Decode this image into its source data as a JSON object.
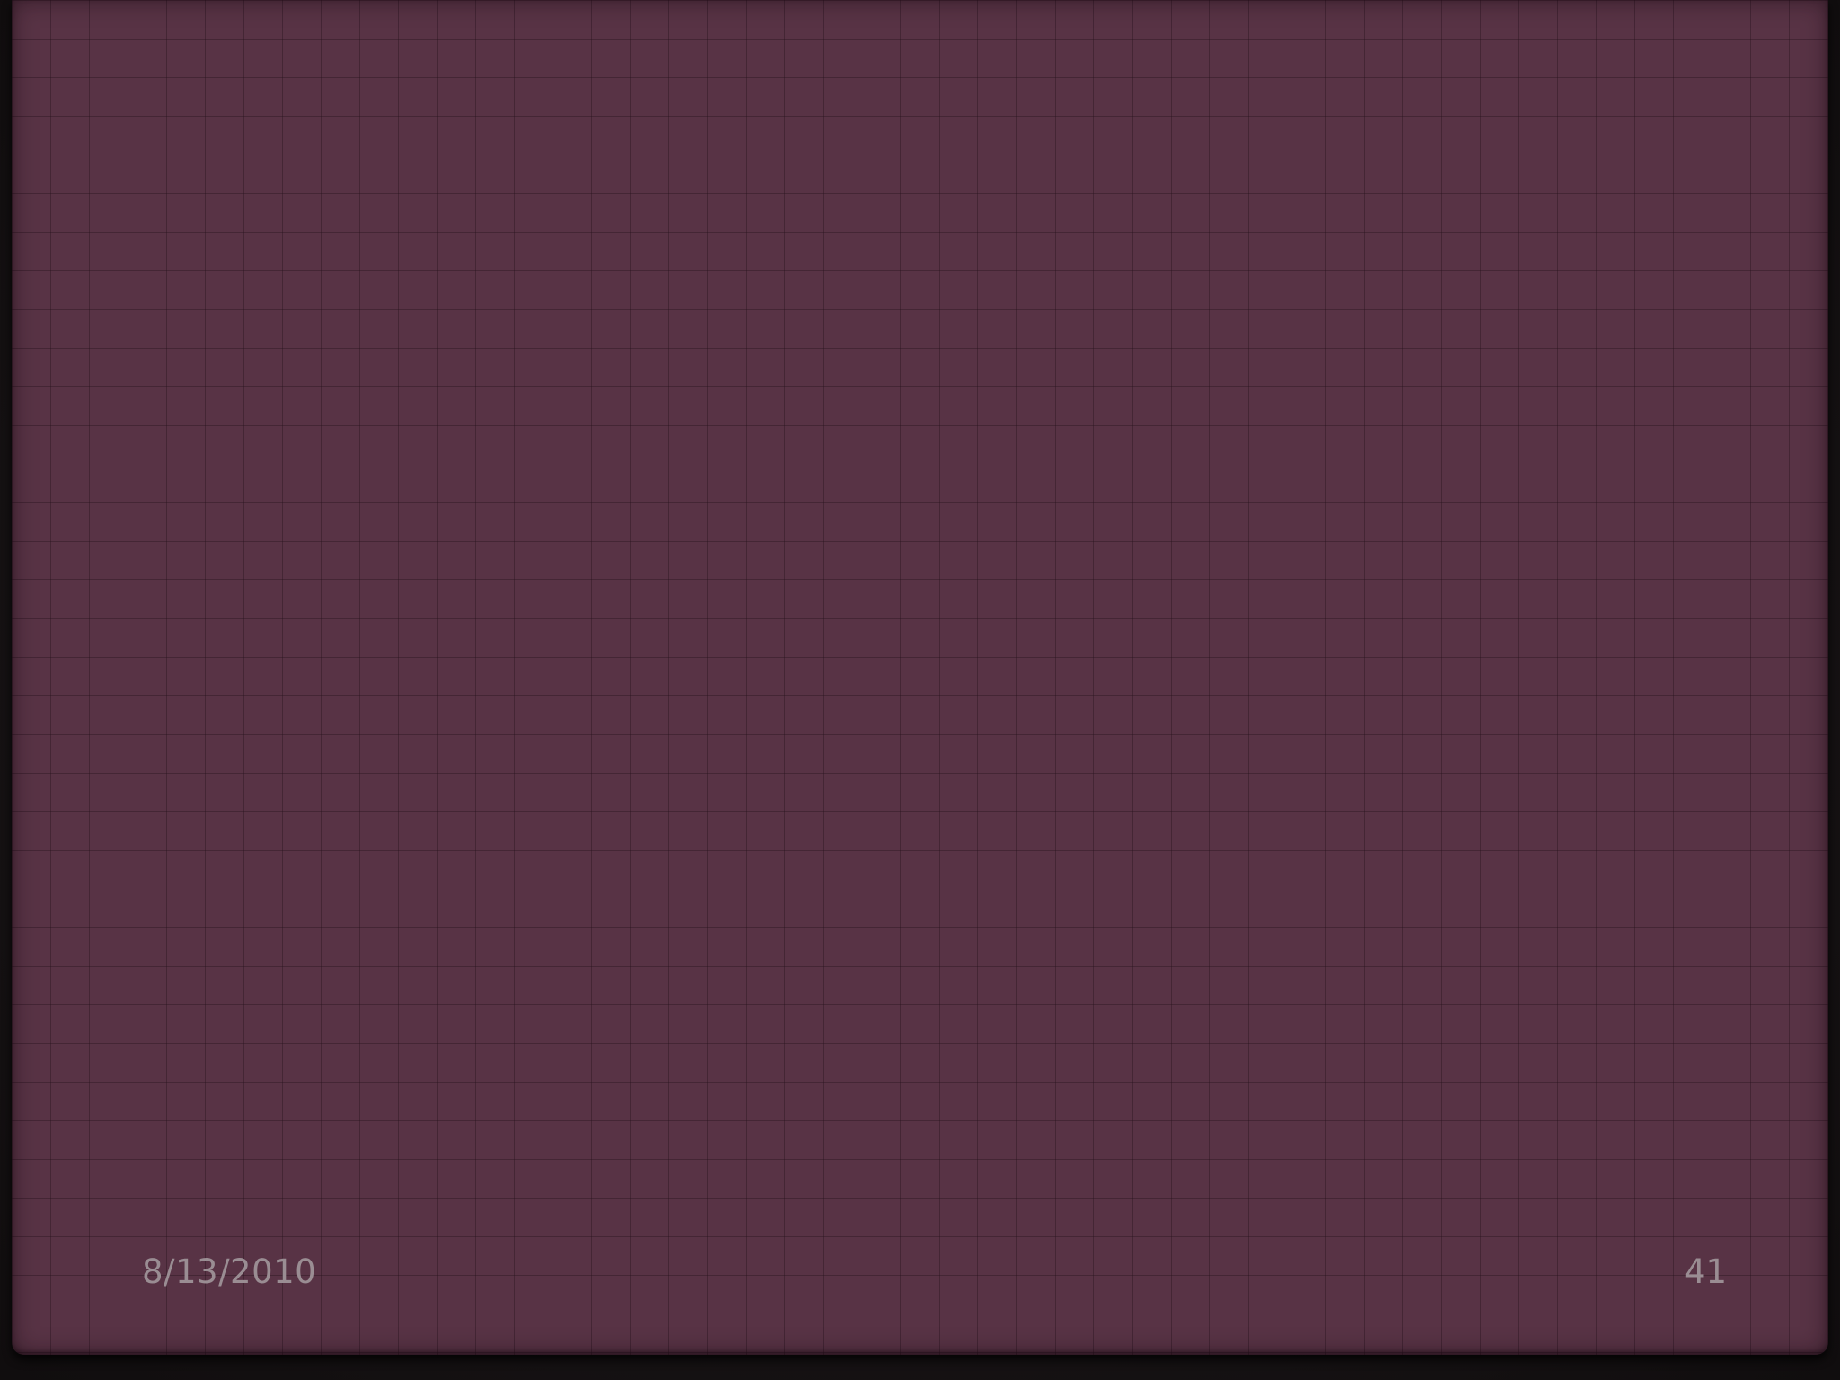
{
  "slide": {
    "footer": {
      "date": "8/13/2010",
      "page_number": "41"
    }
  },
  "colors": {
    "slide_background": "#583345",
    "grid_line": "#3a2230",
    "footer_text": "#9a8d93",
    "frame_background": "#151213"
  }
}
